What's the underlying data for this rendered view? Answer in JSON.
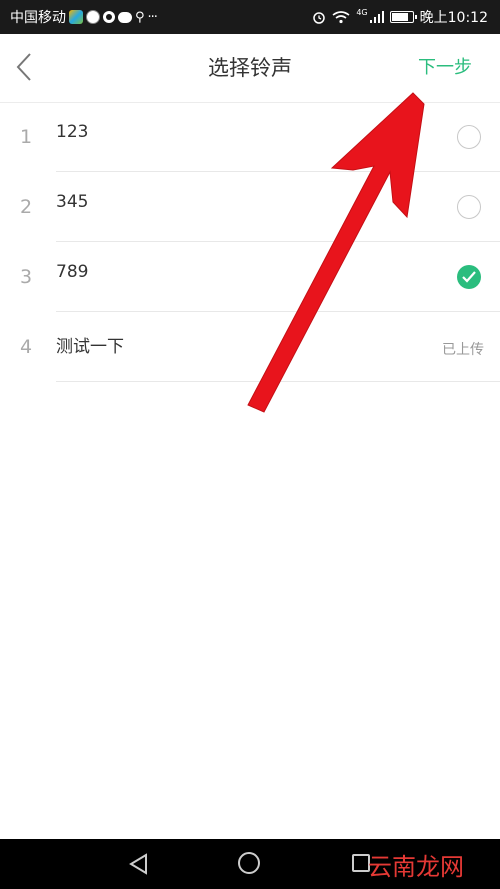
{
  "status_bar": {
    "carrier": "中国移动",
    "network": "4G",
    "time": "晚上10:12",
    "more_dots": "···"
  },
  "header": {
    "title": "选择铃声",
    "next_label": "下一步"
  },
  "ringtones": [
    {
      "index": "1",
      "name": "123",
      "selected": false,
      "status": ""
    },
    {
      "index": "2",
      "name": "345",
      "selected": false,
      "status": ""
    },
    {
      "index": "3",
      "name": "789",
      "selected": true,
      "status": ""
    },
    {
      "index": "4",
      "name": "测试一下",
      "selected": false,
      "status": "已上传"
    }
  ],
  "watermark": "云南龙网",
  "colors": {
    "accent": "#2bbd7e",
    "annotation_arrow": "#e8141c",
    "status_bar_bg": "#1a1a1a",
    "nav_bar_bg": "#000000"
  },
  "icons": {
    "back": "chevron-left-icon",
    "checked": "check-circle-icon",
    "unchecked": "radio-empty-icon",
    "nav_back": "triangle-back-icon",
    "nav_home": "circle-home-icon",
    "nav_recent": "square-recent-icon"
  }
}
